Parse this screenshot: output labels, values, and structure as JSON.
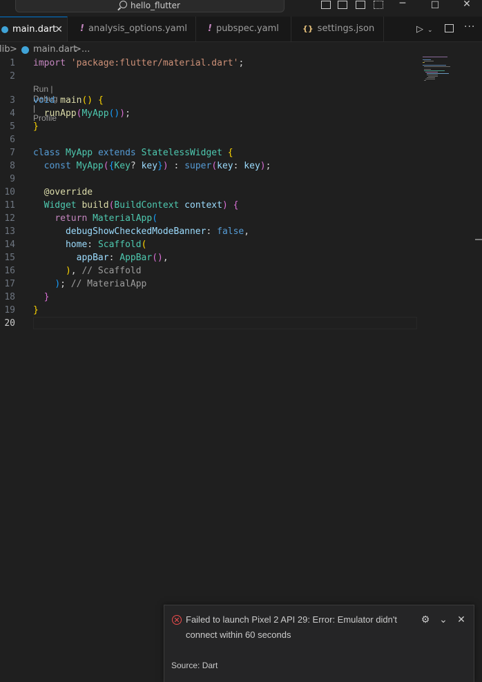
{
  "titlebar": {
    "search_text": "hello_flutter"
  },
  "tabs": [
    {
      "label": "main.dart",
      "icon": "dart-icon"
    },
    {
      "label": "analysis_options.yaml",
      "icon": "!"
    },
    {
      "label": "pubspec.yaml",
      "icon": "!"
    },
    {
      "label": "settings.json",
      "icon": "{}"
    }
  ],
  "breadcrumb": {
    "folder": "lib",
    "file": "main.dart",
    "more": "..."
  },
  "editor": {
    "codelens": "Run | Debug | Profile",
    "line_numbers": [
      "1",
      "2",
      "3",
      "4",
      "5",
      "6",
      "7",
      "8",
      "9",
      "10",
      "11",
      "12",
      "13",
      "14",
      "15",
      "16",
      "17",
      "18",
      "19",
      "20"
    ],
    "current_line": "20",
    "tokens": {
      "l1": [
        "import",
        " ",
        "'package:flutter/material.dart'",
        ";"
      ],
      "l3": [
        "void",
        " ",
        "main",
        "()",
        " ",
        "{"
      ],
      "l4": [
        "  ",
        "runApp",
        "(",
        "MyApp",
        "()",
        ")",
        ";"
      ],
      "l5": [
        "}"
      ],
      "l7": [
        "class",
        " ",
        "MyApp",
        " ",
        "extends",
        " ",
        "StatelessWidget",
        " ",
        "{"
      ],
      "l8": [
        "  ",
        "const",
        " ",
        "MyApp",
        "(",
        "{",
        "Key",
        "?",
        " ",
        "key",
        "}",
        ")",
        " : ",
        "super",
        "(",
        "key",
        ": ",
        "key",
        ")",
        ";"
      ],
      "l10": [
        "  ",
        "@override"
      ],
      "l11": [
        "  ",
        "Widget",
        " ",
        "build",
        "(",
        "BuildContext",
        " ",
        "context",
        ")",
        " ",
        "{"
      ],
      "l12": [
        "    ",
        "return",
        " ",
        "MaterialApp",
        "("
      ],
      "l13": [
        "      ",
        "debugShowCheckedModeBanner",
        ": ",
        "false",
        ","
      ],
      "l14": [
        "      ",
        "home",
        ": ",
        "Scaffold",
        "("
      ],
      "l15": [
        "        ",
        "appBar",
        ": ",
        "AppBar",
        "()",
        ","
      ],
      "l16": [
        "      ",
        ")",
        ", ",
        "// Scaffold"
      ],
      "l17": [
        "    ",
        ")",
        "; ",
        "// MaterialApp"
      ],
      "l18": [
        "  ",
        "}"
      ],
      "l19": [
        "}"
      ]
    }
  },
  "notification": {
    "message": "Failed to launch Pixel 2 API 29: Error: Emulator didn't connect within 60 seconds",
    "source": "Source: Dart"
  },
  "colors": {
    "accent": "#0078d4",
    "error": "#f14c4c",
    "editor_bg": "#1f1f1f"
  }
}
